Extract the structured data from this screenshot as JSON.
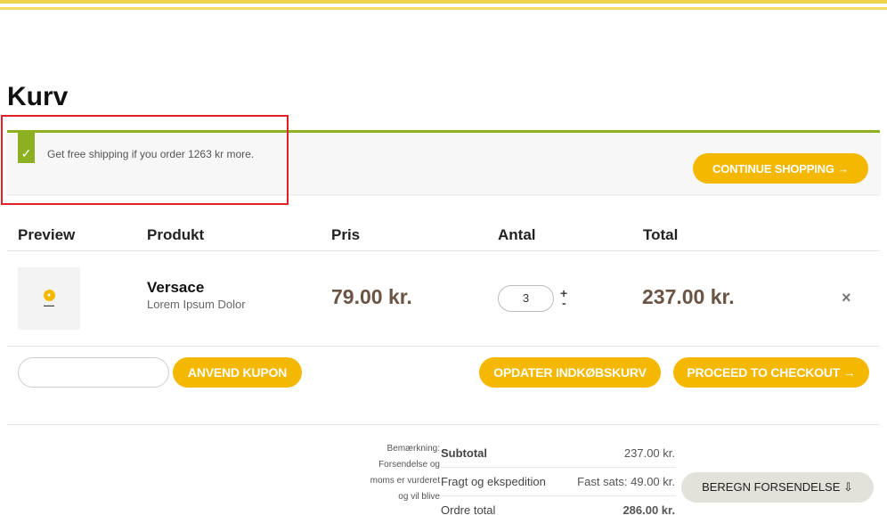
{
  "page_title": "Kurv",
  "notice": {
    "text": "Get free shipping if you order 1263 kr more.",
    "check_icon": "✓",
    "continue_label": "CONTINUE SHOPPING →",
    "accent_color": "#8cb021",
    "highlight_color": "#e1202a"
  },
  "table": {
    "headers": {
      "preview": "Preview",
      "product": "Produkt",
      "price": "Pris",
      "qty": "Antal",
      "total": "Total"
    },
    "rows": [
      {
        "name": "Versace",
        "description": "Lorem Ipsum Dolor",
        "price": "79.00 kr.",
        "qty": "3",
        "total": "237.00 kr.",
        "thumb_icon": "logo-icon"
      }
    ],
    "qty_plus": "+",
    "qty_minus": "-",
    "remove_icon": "×"
  },
  "actions": {
    "coupon_placeholder": "",
    "coupon_label": "ANVEND KUPON",
    "update_label": "OPDATER INDKØBSKURV",
    "checkout_label": "PROCEED TO CHECKOUT →",
    "button_color": "#f5b800"
  },
  "totals": {
    "note": "Bemærkning: Forsendelse og moms er vurderet og vil blive",
    "subtotal_label": "Subtotal",
    "subtotal_value": "237.00 kr.",
    "shipping_label": "Fragt og ekspedition",
    "shipping_value": "Fast sats: 49.00 kr.",
    "order_total_label": "Ordre total",
    "order_total_value": "286.00 kr.",
    "calc_shipping_label": "BEREGN FORSENDELSE ⇩"
  }
}
